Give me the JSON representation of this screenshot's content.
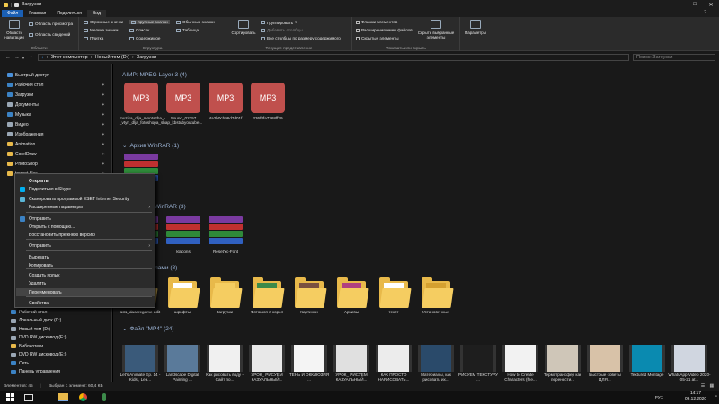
{
  "window": {
    "title": "Загрузки"
  },
  "ribbon_tabs": [
    {
      "label": "Файл"
    },
    {
      "label": "Главная"
    },
    {
      "label": "Поделиться"
    },
    {
      "label": "Вид"
    }
  ],
  "ribbon": {
    "panes": {
      "caption": "Области",
      "nav_pane": "Область навигации",
      "preview_pane": "Область просмотра",
      "details_pane": "Область сведений"
    },
    "layout": {
      "caption": "Структура",
      "huge_icons": "Огромные значки",
      "large_icons": "Крупные значки",
      "medium_icons": "Обычные значки",
      "small_icons": "Мелкие значки",
      "list": "Список",
      "details": "Таблица",
      "tiles": "Плитка",
      "content": "Содержимое"
    },
    "current_view": {
      "caption": "Текущее представление",
      "sort": "Сортировать",
      "group_by": "Группировать",
      "add_columns": "Добавить столбцы",
      "size_columns": "Все столбцы по размеру содержимого"
    },
    "show_hide": {
      "caption": "Показать или скрыть",
      "item_checkboxes": "Флажки элементов",
      "file_extensions": "Расширения имен файлов",
      "hidden_items": "Скрытые элементы",
      "hide_selected": "Скрыть выбранные элементы"
    },
    "options": "Параметры"
  },
  "address": {
    "path": [
      "Этот компьютер",
      "Новый том (D:)",
      "Загрузки"
    ],
    "search_placeholder": "Поиск: Загрузки"
  },
  "nav": {
    "items": [
      {
        "label": "Быстрый доступ",
        "color": "#4a90d9",
        "pinned": false
      },
      {
        "label": "Рабочий стол",
        "color": "#3b82c4",
        "pinned": true
      },
      {
        "label": "Загрузки",
        "color": "#3b82c4",
        "pinned": true
      },
      {
        "label": "Документы",
        "color": "#9aa7b5",
        "pinned": true
      },
      {
        "label": "Музыка",
        "color": "#3b82c4",
        "pinned": true
      },
      {
        "label": "Видео",
        "color": "#9aa7b5",
        "pinned": true
      },
      {
        "label": "Изображения",
        "color": "#9aa7b5",
        "pinned": true
      },
      {
        "label": "Animation",
        "color": "#e8b94a",
        "pinned": true
      },
      {
        "label": "CorelDraw",
        "color": "#e8b94a",
        "pinned": true
      },
      {
        "label": "PhotoShop",
        "color": "#e8b94a",
        "pinned": true
      },
      {
        "label": "torrent files",
        "color": "#e8b94a",
        "pinned": true
      }
    ],
    "bottom_items": [
      {
        "label": "Рабочий стол",
        "color": "#3b82c4"
      },
      {
        "label": "Локальный диск (C:)",
        "color": "#9aa7b5"
      },
      {
        "label": "Новый том (D:)",
        "color": "#9aa7b5"
      },
      {
        "label": "DVD RW дисковод (E:)",
        "color": "#9aa7b5"
      },
      {
        "label": "Библиотеки",
        "color": "#e8b94a"
      },
      {
        "label": "DVD RW дисковод (E:)",
        "color": "#9aa7b5"
      },
      {
        "label": "Сеть",
        "color": "#3b82c4"
      },
      {
        "label": "Панель управления",
        "color": "#3b82c4"
      }
    ]
  },
  "groups": {
    "mp3": "AIMP: MPEG Layer 3 (4)",
    "winrar_archive": "Архив WinRAR (1)",
    "winrar_zip": "WinRAR (3)",
    "folders": "лами (8)",
    "mp4": "Файл \"MP4\" (24)"
  },
  "mp3_files": [
    {
      "badge": "MP3",
      "name": "muzika_dlja_montazha_-_vtyn_dlja_fotoshopa_shap_kbstubyoutube..."
    },
    {
      "badge": "MP3",
      "name": "Sound_02357"
    },
    {
      "badge": "MP3",
      "name": "4a2b0cb96d7d01f"
    },
    {
      "badge": "MP3",
      "name": "336f8fa7268ff39"
    }
  ],
  "rar_files": [
    {
      "name": ""
    },
    {
      "name": "klacons"
    },
    {
      "name": "ResetYc-Font"
    }
  ],
  "folders": [
    {
      "name": "131_dacaregame edit",
      "art": "#7a6a50"
    },
    {
      "name": "шрифты",
      "art": "#ffffff"
    },
    {
      "name": "Загрузки",
      "art": "#f5cd61"
    },
    {
      "name": "Фотошоп в корел",
      "art": "#3c8a4a"
    },
    {
      "name": "Картинки",
      "art": "#7a5040"
    },
    {
      "name": "Архивы",
      "art": "#b04080"
    },
    {
      "name": "текст",
      "art": "#ffffff"
    },
    {
      "name": "Установочные",
      "art": "#d4a030"
    }
  ],
  "videos": [
    {
      "name": "Let's Animate Ep. 14 - Kids , Lea...",
      "thumb": "#3a5a7a"
    },
    {
      "name": "Landscape Digital Painting ...",
      "thumb": "#5a7a9a"
    },
    {
      "name": "Как рисовать воду - Сайт по...",
      "thumb": "#f0f0f0"
    },
    {
      "name": "УРОК_ РИСУЕМ КАЗУАЛЬНЫЙ...",
      "thumb": "#e8e8e8"
    },
    {
      "name": "ТЕНЬ И ОККЛЮЗИЯ ...",
      "thumb": "#f4f4f4"
    },
    {
      "name": "УРОК_ РИСУЕМ КАЗУАЛЬНЫЙ...",
      "thumb": "#e0e0e0"
    },
    {
      "name": "КАК ПРОСТО НАРИСОВАТЬ...",
      "thumb": "#ececec"
    },
    {
      "name": "Материалы, как рисовать их...",
      "thumb": "#2a4a6a"
    },
    {
      "name": "РИСУЕМ ТЕКСТУРУ ...",
      "thumb": "#1e1e1e"
    },
    {
      "name": "How to Create Characters (the...",
      "thumb": "#f2f2f2"
    },
    {
      "name": "Термотрансфер как перенести...",
      "thumb": "#cfc6b8"
    },
    {
      "name": "Быстрые советы ДЛЯ...",
      "thumb": "#d8c2a8"
    },
    {
      "name": "Textured Montage",
      "thumb": "#0a8ab0"
    },
    {
      "name": "WhatsApp Video 2020-05-21 at...",
      "thumb": "#d0d6e0"
    }
  ],
  "context_menu": {
    "items": [
      {
        "label": "Открыть",
        "bold": true
      },
      {
        "label": "Поделиться в Skype",
        "icon": "#00aff0"
      },
      {
        "label": "Сканировать программой ESET Internet Security",
        "icon": "#5ab5d6"
      },
      {
        "label": "Расширенные параметры",
        "arrow": true
      },
      {
        "label": "Отправить",
        "icon": "#3b82c4"
      },
      {
        "label": "Открыть с помощью..."
      },
      {
        "label": "Восстановить прежнюю версию"
      },
      {
        "label": "Отправить",
        "arrow": true
      },
      {
        "label": "Вырезать"
      },
      {
        "label": "Копировать"
      },
      {
        "label": "Создать ярлык"
      },
      {
        "label": "Удалить"
      },
      {
        "label": "Переименовать",
        "highlight": true
      },
      {
        "label": "Свойства"
      }
    ]
  },
  "status": {
    "count": "Элементов: 45",
    "selection": "Выбран 1 элемент: 60,4 КБ"
  },
  "taskbar": {
    "time": "14:17",
    "date": "09.12.2020",
    "lang": "РУС"
  }
}
